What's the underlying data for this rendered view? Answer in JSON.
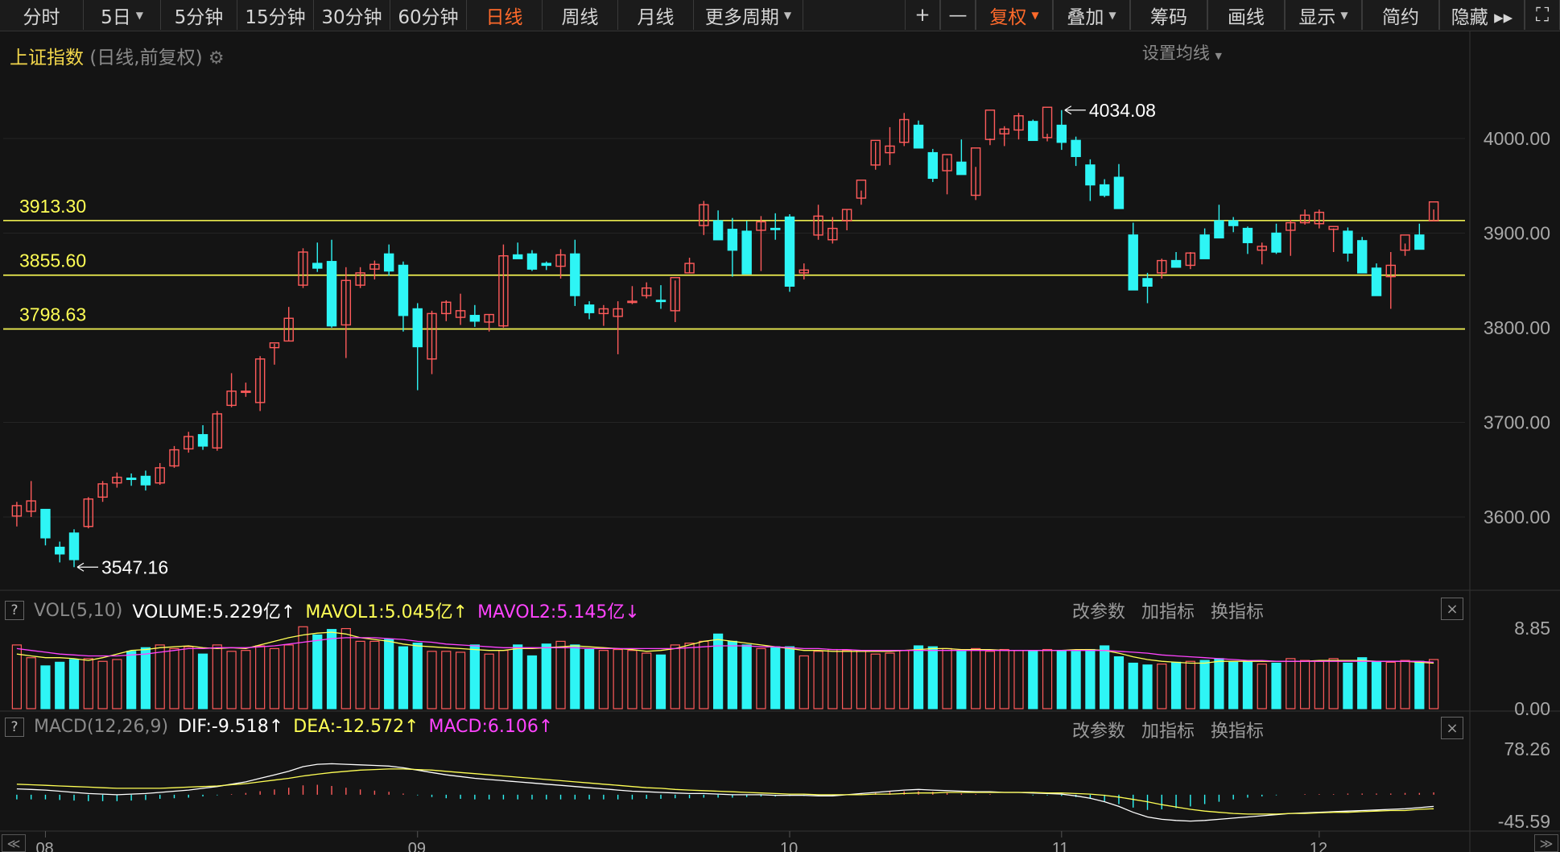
{
  "toolbar": {
    "tabs": [
      {
        "label": "分时",
        "caret": false,
        "active": false
      },
      {
        "label": "5日",
        "caret": true,
        "active": false
      },
      {
        "label": "5分钟",
        "caret": false,
        "active": false
      },
      {
        "label": "15分钟",
        "caret": false,
        "active": false
      },
      {
        "label": "30分钟",
        "caret": false,
        "active": false
      },
      {
        "label": "60分钟",
        "caret": false,
        "active": false
      },
      {
        "label": "日线",
        "caret": false,
        "active": true
      },
      {
        "label": "周线",
        "caret": false,
        "active": false
      },
      {
        "label": "月线",
        "caret": false,
        "active": false
      },
      {
        "label": "更多周期",
        "caret": true,
        "active": false
      }
    ],
    "right_tools": [
      {
        "label": "+",
        "caret": false,
        "active": false
      },
      {
        "label": "—",
        "caret": false,
        "active": false
      },
      {
        "label": "复权",
        "caret": true,
        "active": true
      },
      {
        "label": "叠加",
        "caret": true,
        "active": false
      },
      {
        "label": "筹码",
        "caret": false,
        "active": false
      },
      {
        "label": "画线",
        "caret": false,
        "active": false
      },
      {
        "label": "显示",
        "caret": true,
        "active": false
      },
      {
        "label": "简约",
        "caret": false,
        "active": false
      },
      {
        "label": "隐藏 ▸▸",
        "caret": false,
        "active": false
      },
      {
        "label": "⛶",
        "caret": false,
        "active": false
      }
    ]
  },
  "header": {
    "title": "上证指数",
    "subtitle": "(日线,前复权)",
    "ma_settings": "设置均线"
  },
  "colors": {
    "up": "#ff5b5b",
    "down": "#2ef5f5",
    "level_line": "#ffff55",
    "annotation": "#ffffff",
    "vol_ma1": "#ffff55",
    "vol_ma2": "#ff44ff",
    "dif": "#ffffff",
    "dea": "#ffff55"
  },
  "volume_panel": {
    "name": "VOL(5,10)",
    "volume": "VOLUME:5.229亿",
    "mavol1": "MAVOL1:5.045亿",
    "mavol2": "MAVOL2:5.145亿",
    "volume_arrow": "↑",
    "mavol1_arrow": "↑",
    "mavol2_arrow": "↓",
    "axis_ticks": [
      "8.85",
      "0.00"
    ]
  },
  "macd_panel": {
    "name": "MACD(12,26,9)",
    "dif": "DIF:-9.518",
    "dea": "DEA:-12.572",
    "macd": "MACD:6.106",
    "dif_arrow": "↑",
    "dea_arrow": "↑",
    "macd_arrow": "↑",
    "axis_ticks": [
      "78.26",
      "-45.59"
    ]
  },
  "panel_actions": [
    "改参数",
    "加指标",
    "换指标"
  ],
  "panel_help": "?",
  "panel_close": "×",
  "nav": {
    "left": "≪",
    "right": "≫"
  },
  "chart_data": {
    "type": "candlestick",
    "title": "上证指数",
    "y_ticks": [
      4000,
      3900,
      3800,
      3700,
      3600
    ],
    "y_tick_labels": [
      "4000.00",
      "3900.00",
      "3800.00",
      "3700.00",
      "3600.00"
    ],
    "ylim": [
      3547.16,
      4034.08
    ],
    "x_month_labels": [
      "08",
      "09",
      "10",
      "11",
      "12"
    ],
    "reference_lines": [
      {
        "value": 3913.3,
        "label": "3913.30"
      },
      {
        "value": 3855.6,
        "label": "3855.60"
      },
      {
        "value": 3798.63,
        "label": "3798.63"
      }
    ],
    "high_label": "4034.08",
    "low_label": "3547.16",
    "candles": [
      [
        3601,
        3616,
        3590,
        3612
      ],
      [
        3606,
        3638,
        3600,
        3617
      ],
      [
        3608,
        3608,
        3570,
        3578
      ],
      [
        3568,
        3574,
        3552,
        3561
      ],
      [
        3583,
        3587,
        3547,
        3555
      ],
      [
        3590,
        3621,
        3588,
        3619
      ],
      [
        3621,
        3638,
        3616,
        3635
      ],
      [
        3636,
        3647,
        3631,
        3642
      ],
      [
        3641,
        3646,
        3633,
        3640
      ],
      [
        3643,
        3649,
        3628,
        3634
      ],
      [
        3636,
        3657,
        3634,
        3652
      ],
      [
        3654,
        3675,
        3652,
        3671
      ],
      [
        3672,
        3690,
        3668,
        3685
      ],
      [
        3687,
        3697,
        3671,
        3675
      ],
      [
        3673,
        3712,
        3670,
        3709
      ],
      [
        3718,
        3752,
        3716,
        3733
      ],
      [
        3733,
        3742,
        3727,
        3733
      ],
      [
        3721,
        3770,
        3712,
        3767
      ],
      [
        3779,
        3783,
        3761,
        3784
      ],
      [
        3786,
        3822,
        3786,
        3810
      ],
      [
        3845,
        3884,
        3842,
        3880
      ],
      [
        3868,
        3890,
        3859,
        3863
      ],
      [
        3870,
        3893,
        3800,
        3802
      ],
      [
        3803,
        3864,
        3768,
        3850
      ],
      [
        3845,
        3864,
        3842,
        3858
      ],
      [
        3862,
        3871,
        3851,
        3867
      ],
      [
        3878,
        3888,
        3855,
        3860
      ],
      [
        3866,
        3870,
        3796,
        3813
      ],
      [
        3820,
        3826,
        3734,
        3780
      ],
      [
        3767,
        3818,
        3751,
        3815
      ],
      [
        3815,
        3829,
        3807,
        3827
      ],
      [
        3811,
        3836,
        3803,
        3818
      ],
      [
        3813,
        3824,
        3801,
        3807
      ],
      [
        3806,
        3814,
        3796,
        3814
      ],
      [
        3802,
        3888,
        3800,
        3876
      ],
      [
        3877,
        3890,
        3874,
        3873
      ],
      [
        3878,
        3882,
        3860,
        3862
      ],
      [
        3868,
        3870,
        3861,
        3866
      ],
      [
        3865,
        3883,
        3852,
        3877
      ],
      [
        3878,
        3893,
        3823,
        3834
      ],
      [
        3824,
        3828,
        3809,
        3816
      ],
      [
        3815,
        3824,
        3802,
        3820
      ],
      [
        3812,
        3828,
        3772,
        3820
      ],
      [
        3828,
        3844,
        3825,
        3828
      ],
      [
        3834,
        3848,
        3831,
        3842
      ],
      [
        3829,
        3845,
        3820,
        3828
      ],
      [
        3818,
        3850,
        3806,
        3853
      ],
      [
        3858,
        3874,
        3858,
        3868
      ],
      [
        3908,
        3934,
        3898,
        3930
      ],
      [
        3913,
        3924,
        3898,
        3893
      ],
      [
        3904,
        3916,
        3854,
        3882
      ],
      [
        3902,
        3913,
        3867,
        3857
      ],
      [
        3903,
        3918,
        3860,
        3912
      ],
      [
        3905,
        3921,
        3893,
        3904
      ],
      [
        3917,
        3920,
        3838,
        3844
      ],
      [
        3858,
        3868,
        3851,
        3861
      ],
      [
        3898,
        3930,
        3893,
        3918
      ],
      [
        3893,
        3917,
        3889,
        3905
      ],
      [
        3913,
        3925,
        3903,
        3925
      ],
      [
        3937,
        3945,
        3930,
        3956
      ],
      [
        3972,
        3996,
        3967,
        3998
      ],
      [
        3985,
        4012,
        3972,
        3992
      ],
      [
        3996,
        4027,
        3992,
        4020
      ],
      [
        4014,
        4019,
        3990,
        3990
      ],
      [
        3985,
        3989,
        3954,
        3958
      ],
      [
        3966,
        3979,
        3941,
        3983
      ],
      [
        3975,
        3999,
        3963,
        3962
      ],
      [
        3940,
        3970,
        3935,
        3990
      ],
      [
        3999,
        4000,
        3993,
        4030
      ],
      [
        4005,
        4013,
        3992,
        4010
      ],
      [
        4009,
        4027,
        3999,
        4024
      ],
      [
        4018,
        4020,
        4003,
        3998
      ],
      [
        4001,
        4005,
        3997,
        4033
      ],
      [
        4014,
        4030,
        3988,
        3996
      ],
      [
        3998,
        4002,
        3971,
        3981
      ],
      [
        3972,
        3978,
        3934,
        3951
      ],
      [
        3951,
        3957,
        3938,
        3940
      ],
      [
        3959,
        3973,
        3951,
        3926
      ],
      [
        3898,
        3911,
        3859,
        3840
      ],
      [
        3852,
        3858,
        3826,
        3844
      ],
      [
        3858,
        3873,
        3852,
        3871
      ],
      [
        3871,
        3880,
        3868,
        3864
      ],
      [
        3866,
        3880,
        3862,
        3879
      ],
      [
        3898,
        3905,
        3883,
        3873
      ],
      [
        3913,
        3930,
        3911,
        3895
      ],
      [
        3913,
        3917,
        3901,
        3908
      ],
      [
        3905,
        3907,
        3878,
        3890
      ],
      [
        3882,
        3890,
        3867,
        3886
      ],
      [
        3900,
        3910,
        3878,
        3880
      ],
      [
        3903,
        3914,
        3876,
        3911
      ],
      [
        3911,
        3925,
        3909,
        3919
      ],
      [
        3910,
        3925,
        3905,
        3922
      ],
      [
        3904,
        3905,
        3880,
        3907
      ],
      [
        3902,
        3906,
        3870,
        3879
      ],
      [
        3892,
        3896,
        3865,
        3858
      ],
      [
        3863,
        3868,
        3841,
        3834
      ],
      [
        3854,
        3880,
        3820,
        3866
      ],
      [
        3882,
        3889,
        3876,
        3898
      ],
      [
        3898,
        3910,
        3887,
        3883
      ],
      [
        3913,
        3925,
        3913,
        3933
      ]
    ],
    "volume": [
      7.0,
      5.6,
      4.7,
      5.1,
      5.4,
      5.5,
      5.2,
      5.4,
      6.3,
      6.7,
      7.0,
      6.6,
      6.8,
      6.0,
      7.0,
      6.3,
      6.4,
      6.9,
      6.6,
      7.0,
      9.0,
      8.1,
      8.7,
      8.8,
      7.4,
      7.4,
      7.6,
      6.8,
      7.2,
      6.3,
      6.3,
      6.2,
      7.0,
      6.0,
      6.4,
      7.0,
      5.8,
      7.1,
      7.4,
      7.0,
      6.5,
      6.4,
      6.5,
      6.4,
      6.1,
      5.9,
      7.0,
      7.2,
      7.4,
      8.2,
      7.4,
      7.0,
      6.6,
      6.8,
      6.8,
      5.8,
      6.3,
      6.5,
      6.4,
      6.4,
      6.0,
      6.1,
      6.4,
      6.9,
      6.8,
      6.6,
      6.3,
      6.6,
      6.3,
      6.5,
      6.4,
      6.3,
      6.5,
      6.4,
      6.3,
      6.5,
      6.9,
      5.7,
      5.0,
      4.8,
      4.9,
      5.1,
      5.2,
      5.3,
      5.5,
      5.1,
      5.2,
      4.9,
      5.0,
      5.5,
      5.3,
      5.2,
      5.5,
      5.0,
      5.6,
      5.2,
      5.1,
      5.3,
      5.2,
      5.4
    ],
    "mavol1": [
      6.0,
      5.8,
      5.6,
      5.6,
      5.5,
      5.3,
      5.6,
      6.0,
      6.4,
      6.5,
      6.7,
      6.8,
      6.9,
      6.7,
      6.6,
      6.7,
      6.6,
      7.0,
      7.4,
      7.8,
      8.1,
      8.3,
      8.4,
      8.2,
      7.8,
      7.6,
      7.4,
      7.1,
      6.9,
      6.8,
      6.7,
      6.6,
      6.5,
      6.4,
      6.4,
      6.6,
      6.6,
      6.7,
      6.8,
      6.9,
      6.8,
      6.7,
      6.6,
      6.5,
      6.3,
      6.4,
      6.6,
      7.0,
      7.4,
      7.6,
      7.4,
      7.2,
      7.0,
      6.8,
      6.6,
      6.4,
      6.4,
      6.3,
      6.3,
      6.3,
      6.3,
      6.3,
      6.4,
      6.5,
      6.6,
      6.6,
      6.5,
      6.5,
      6.5,
      6.4,
      6.4,
      6.4,
      6.4,
      6.4,
      6.5,
      6.5,
      6.4,
      6.1,
      5.7,
      5.4,
      5.2,
      5.1,
      5.0,
      5.0,
      5.2,
      5.2,
      5.2,
      5.2,
      5.2,
      5.2,
      5.2,
      5.3,
      5.3,
      5.3,
      5.3,
      5.2,
      5.2,
      5.2,
      5.1,
      5.0
    ],
    "mavol2": [
      6.6,
      6.4,
      6.2,
      6.0,
      5.9,
      5.8,
      5.8,
      5.8,
      5.9,
      6.0,
      6.2,
      6.4,
      6.6,
      6.6,
      6.7,
      6.7,
      6.7,
      6.8,
      6.9,
      7.1,
      7.3,
      7.5,
      7.7,
      7.8,
      7.8,
      7.8,
      7.7,
      7.6,
      7.4,
      7.3,
      7.1,
      7.0,
      6.9,
      6.8,
      6.7,
      6.7,
      6.7,
      6.7,
      6.7,
      6.7,
      6.6,
      6.6,
      6.6,
      6.6,
      6.6,
      6.6,
      6.6,
      6.7,
      6.8,
      6.9,
      6.9,
      6.9,
      6.8,
      6.8,
      6.7,
      6.6,
      6.6,
      6.5,
      6.5,
      6.4,
      6.4,
      6.4,
      6.4,
      6.4,
      6.4,
      6.4,
      6.4,
      6.4,
      6.4,
      6.4,
      6.4,
      6.4,
      6.4,
      6.4,
      6.4,
      6.4,
      6.4,
      6.3,
      6.2,
      6.1,
      5.9,
      5.8,
      5.7,
      5.6,
      5.5,
      5.4,
      5.3,
      5.3,
      5.2,
      5.2,
      5.2,
      5.2,
      5.2,
      5.2,
      5.2,
      5.2,
      5.2,
      5.2,
      5.2,
      5.1
    ],
    "dif": [
      10,
      9,
      8,
      6,
      4,
      2,
      1,
      0,
      1,
      2,
      4,
      6,
      8,
      11,
      14,
      18,
      22,
      28,
      34,
      40,
      48,
      52,
      53,
      52,
      51,
      50,
      49,
      46,
      42,
      38,
      34,
      31,
      28,
      26,
      24,
      22,
      20,
      18,
      16,
      14,
      12,
      10,
      8,
      6,
      5,
      4,
      3,
      2,
      2,
      1,
      0,
      0,
      0,
      -1,
      -1,
      -1,
      -2,
      -2,
      0,
      2,
      4,
      6,
      8,
      9,
      8,
      7,
      6,
      5,
      5,
      4,
      4,
      3,
      2,
      1,
      -2,
      -6,
      -12,
      -20,
      -30,
      -38,
      -42,
      -44,
      -45,
      -44,
      -42,
      -40,
      -38,
      -36,
      -34,
      -32,
      -31,
      -30,
      -29,
      -28,
      -27,
      -26,
      -25,
      -24,
      -22,
      -20
    ],
    "dea": [
      18,
      17,
      16,
      15,
      14,
      13,
      12,
      11,
      11,
      11,
      11,
      12,
      13,
      14,
      15,
      17,
      19,
      22,
      25,
      28,
      32,
      35,
      38,
      40,
      42,
      43,
      44,
      44,
      43,
      42,
      40,
      38,
      36,
      34,
      32,
      30,
      28,
      26,
      24,
      22,
      20,
      18,
      16,
      14,
      12,
      11,
      9,
      8,
      7,
      6,
      5,
      4,
      3,
      2,
      1,
      1,
      0,
      0,
      0,
      0,
      1,
      1,
      2,
      3,
      3,
      4,
      4,
      4,
      4,
      4,
      4,
      4,
      3,
      3,
      2,
      1,
      -1,
      -4,
      -8,
      -12,
      -17,
      -21,
      -25,
      -28,
      -30,
      -32,
      -33,
      -33,
      -33,
      -32,
      -32,
      -31,
      -30,
      -30,
      -29,
      -28,
      -27,
      -27,
      -25,
      -24
    ],
    "macd": [
      -8,
      -8,
      -8,
      -9,
      -10,
      -11,
      -11,
      -11,
      -10,
      -9,
      -7,
      -6,
      -5,
      -3,
      -1,
      1,
      3,
      6,
      9,
      12,
      16,
      17,
      15,
      12,
      9,
      7,
      5,
      2,
      -1,
      -4,
      -6,
      -7,
      -8,
      -8,
      -8,
      -8,
      -8,
      -8,
      -8,
      -8,
      -8,
      -8,
      -8,
      -8,
      -7,
      -7,
      -6,
      -6,
      -5,
      -5,
      -5,
      -4,
      -3,
      -3,
      -2,
      -2,
      -2,
      -2,
      0,
      2,
      3,
      5,
      6,
      6,
      5,
      3,
      2,
      1,
      1,
      0,
      0,
      -1,
      -1,
      -2,
      -4,
      -7,
      -11,
      -16,
      -22,
      -26,
      -25,
      -23,
      -20,
      -16,
      -12,
      -8,
      -5,
      -3,
      -1,
      0,
      1,
      1,
      1,
      2,
      2,
      2,
      2,
      3,
      3,
      4
    ]
  }
}
